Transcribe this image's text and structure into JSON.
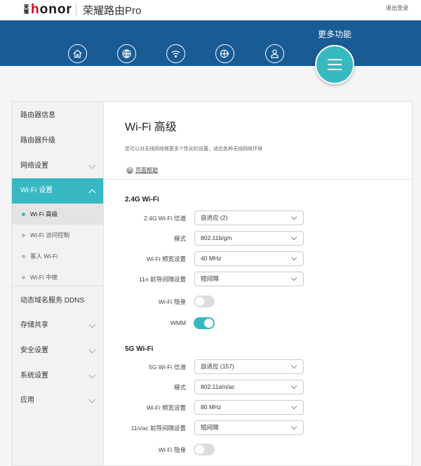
{
  "header": {
    "brand": "honor",
    "brand_small": "荣耀",
    "product": "荣耀路由Pro",
    "logout": "退出登录"
  },
  "banner": {
    "more_label": "更多功能",
    "nav_icons": [
      "home-icon",
      "globe-icon",
      "wifi-icon",
      "globe-lightning-icon",
      "user-icon"
    ]
  },
  "colors": {
    "accent": "#38b9c2",
    "banner": "#195b94"
  },
  "sidebar": {
    "items": [
      {
        "label": "路由器信息"
      },
      {
        "label": "路由器升级"
      },
      {
        "label": "网络设置"
      },
      {
        "label": "Wi-Fi 设置"
      },
      {
        "label": "动态域名服务 DDNS"
      },
      {
        "label": "存储共享"
      },
      {
        "label": "安全设置"
      },
      {
        "label": "系统设置"
      },
      {
        "label": "应用"
      }
    ],
    "subitems": [
      {
        "label": "Wi-Fi 高级"
      },
      {
        "label": "Wi-Fi 访问控制"
      },
      {
        "label": "客人 Wi-Fi"
      },
      {
        "label": "Wi-Fi 中继"
      }
    ]
  },
  "main": {
    "title": "Wi-Fi 高级",
    "description": "您可以对无线网络做更多个性化的设置，适应各种无线网络环境",
    "help": "页面帮助",
    "sections": [
      {
        "title": "2.4G Wi-Fi",
        "fields": [
          {
            "label": "2.4G Wi-Fi 信道",
            "value": "自适应 (2)"
          },
          {
            "label": "模式",
            "value": "802.11b/g/n"
          },
          {
            "label": "Wi-Fi 频宽设置",
            "value": "40 MHz"
          },
          {
            "label": "11n 前导间隔设置",
            "value": "短间隔"
          }
        ],
        "toggles": [
          {
            "label": "Wi-Fi 隐身",
            "on": false
          },
          {
            "label": "WMM",
            "on": true
          }
        ]
      },
      {
        "title": "5G Wi-Fi",
        "fields": [
          {
            "label": "5G Wi-Fi 信道",
            "value": "自适应 (157)"
          },
          {
            "label": "模式",
            "value": "802.11a/n/ac"
          },
          {
            "label": "Wi-Fi 频宽设置",
            "value": "80 MHz"
          },
          {
            "label": "11n/ac 前导间隔设置",
            "value": "短间隔"
          }
        ],
        "toggles": [
          {
            "label": "Wi-Fi 隐身",
            "on": false
          }
        ]
      }
    ]
  }
}
